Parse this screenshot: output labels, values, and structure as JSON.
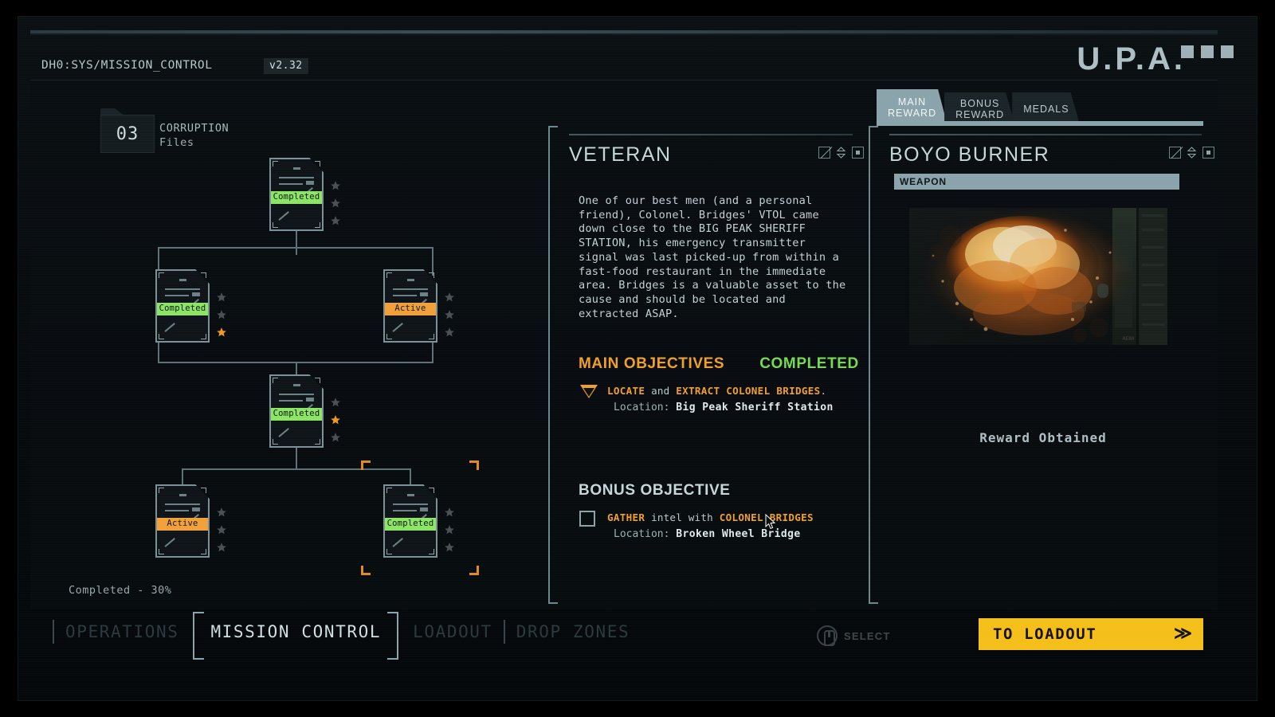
{
  "header": {
    "path": "DH0:SYS/MISSION_CONTROL",
    "version": "v2.32",
    "logo": "U.P.A."
  },
  "tree": {
    "folder_count": "03",
    "folder_label_line1": "CORRUPTION",
    "folder_label_line2": "Files",
    "progress": "Completed - 30%",
    "status_completed": "Completed",
    "status_active": "Active",
    "nodes": [
      {
        "id": "n1",
        "status": "Completed",
        "stars": [
          "empty",
          "empty",
          "empty"
        ],
        "selected": false
      },
      {
        "id": "n2",
        "status": "Completed",
        "stars": [
          "empty",
          "empty",
          "filled"
        ],
        "selected": false
      },
      {
        "id": "n3",
        "status": "Active",
        "stars": [
          "empty",
          "empty",
          "empty"
        ],
        "selected": false
      },
      {
        "id": "n4",
        "status": "Completed",
        "stars": [
          "empty",
          "filled",
          "empty"
        ],
        "selected": false
      },
      {
        "id": "n5",
        "status": "Active",
        "stars": [
          "empty",
          "empty",
          "empty"
        ],
        "selected": false
      },
      {
        "id": "n6",
        "status": "Completed",
        "stars": [
          "empty",
          "empty",
          "empty"
        ],
        "selected": true
      }
    ]
  },
  "mission": {
    "title": "VETERAN",
    "briefing": "One of our best men (and a personal friend), Colonel. Bridges' VTOL came down close to the BIG PEAK SHERIFF STATION, his emergency transmitter signal was last picked-up from within a fast-food restaurant in the immediate area. Bridges is a valuable asset to the cause and should be located and extracted ASAP.",
    "main_objectives": {
      "heading": "MAIN OBJECTIVES",
      "status": "COMPLETED",
      "kw1": "LOCATE",
      "mid": " and ",
      "kw2": "EXTRACT COLONEL BRIDGES",
      "tail": ".",
      "location_label": "Location:",
      "location_value": "Big Peak Sheriff Station"
    },
    "bonus_objective": {
      "heading": "BONUS OBJECTIVE",
      "kw1": "GATHER",
      "mid": " intel with ",
      "kw2": "COLONEL BRIDGES",
      "location_label": "Location:",
      "location_value": "Broken Wheel Bridge"
    }
  },
  "reward": {
    "tabs": [
      {
        "line1": "MAIN",
        "line2": "REWARD",
        "active": true
      },
      {
        "line1": "BONUS",
        "line2": "REWARD",
        "active": false
      },
      {
        "line1": "MEDALS",
        "line2": "",
        "active": false
      }
    ],
    "title": "BOYO BURNER",
    "category": "WEAPON",
    "obtained_text": "Reward Obtained"
  },
  "bottom": {
    "nav": [
      {
        "label": "OPERATIONS",
        "active": false
      },
      {
        "label": "MISSION CONTROL",
        "active": true
      },
      {
        "label": "LOADOUT",
        "active": false
      },
      {
        "label": "DROP ZONES",
        "active": false
      }
    ],
    "select_hint": "SELECT",
    "primary_action": "TO LOADOUT",
    "primary_chevron": "≫"
  },
  "colors": {
    "accent_orange": "#f0a029",
    "accent_green": "#8ce564",
    "accent_yellow": "#f5bf1a",
    "panel_line": "#6e868d",
    "tab_active": "#8ba3aa"
  }
}
